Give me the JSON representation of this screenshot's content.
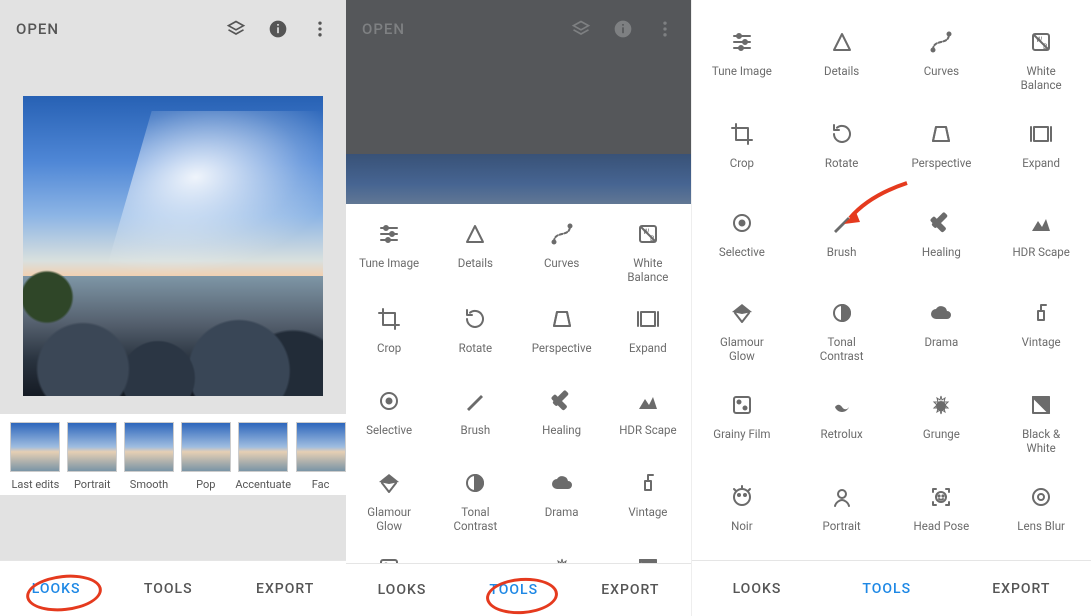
{
  "open_label": "OPEN",
  "nav": {
    "looks": "LOOKS",
    "tools": "TOOLS",
    "export": "EXPORT"
  },
  "thumbs": [
    {
      "label": "Last edits"
    },
    {
      "label": "Portrait"
    },
    {
      "label": "Smooth"
    },
    {
      "label": "Pop"
    },
    {
      "label": "Accentuate"
    },
    {
      "label": "Fac"
    }
  ],
  "tools": [
    {
      "label": "Tune Image",
      "icon": "tune"
    },
    {
      "label": "Details",
      "icon": "details"
    },
    {
      "label": "Curves",
      "icon": "curves"
    },
    {
      "label": "White\nBalance",
      "icon": "whitebalance"
    },
    {
      "label": "Crop",
      "icon": "crop"
    },
    {
      "label": "Rotate",
      "icon": "rotate"
    },
    {
      "label": "Perspective",
      "icon": "perspective"
    },
    {
      "label": "Expand",
      "icon": "expand"
    },
    {
      "label": "Selective",
      "icon": "selective"
    },
    {
      "label": "Brush",
      "icon": "brush"
    },
    {
      "label": "Healing",
      "icon": "healing"
    },
    {
      "label": "HDR Scape",
      "icon": "hdr"
    },
    {
      "label": "Glamour\nGlow",
      "icon": "glamour"
    },
    {
      "label": "Tonal\nContrast",
      "icon": "tonal"
    },
    {
      "label": "Drama",
      "icon": "drama"
    },
    {
      "label": "Vintage",
      "icon": "vintage"
    },
    {
      "label": "Grainy Film",
      "icon": "grainy"
    },
    {
      "label": "Retrolux",
      "icon": "retrolux"
    },
    {
      "label": "Grunge",
      "icon": "grunge"
    },
    {
      "label": "Black &\nWhite",
      "icon": "bw"
    },
    {
      "label": "Noir",
      "icon": "noir"
    },
    {
      "label": "Portrait",
      "icon": "portrait"
    },
    {
      "label": "Head Pose",
      "icon": "headpose"
    },
    {
      "label": "Lens Blur",
      "icon": "lensblur"
    }
  ],
  "panel2_tool_rows_visible": 5
}
